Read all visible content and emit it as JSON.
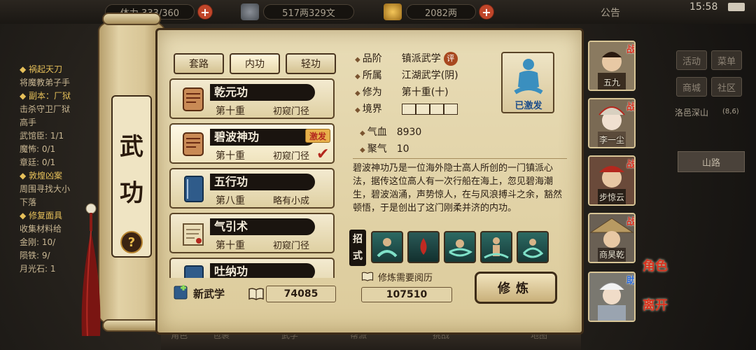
{
  "status_bar": {
    "stamina": "体力 333/360",
    "money": "517两329文",
    "gold": "2082两",
    "announcement": "公告",
    "clock": "15:58"
  },
  "quest_log": {
    "lines": [
      "◆ 祸起天刀",
      "将魔教弟子手",
      "◆ 副本：厂狱",
      "击杀守卫厂狱",
      "高手",
      "武馆臣: 1/1",
      "魔怖: 0/1",
      "章廷: 0/1",
      "◆ 敦煌凶案",
      "周围寻找大小",
      "下落",
      "◆ 修复面具",
      "收集材料给",
      "金刚: 10/",
      "陨铁: 9/",
      "月光石: 1"
    ]
  },
  "right_menu": {
    "activity": "活动",
    "menu": "菜单",
    "shop": "商城",
    "community": "社区",
    "location": "洛邑深山",
    "location_coords": "(8,6)",
    "area_label": "山路"
  },
  "scroll_title": {
    "char1": "武",
    "char2": "功",
    "help": "?"
  },
  "tabs": [
    {
      "label": "套路"
    },
    {
      "label": "内功"
    },
    {
      "label": "轻功"
    }
  ],
  "skills": [
    {
      "name": "乾元功",
      "level": "第十重",
      "stage": "初窥门径",
      "badge": ""
    },
    {
      "name": "碧波神功",
      "level": "第十重",
      "stage": "初窥门径",
      "badge": "激发"
    },
    {
      "name": "五行功",
      "level": "第八重",
      "stage": "略有小成",
      "badge": ""
    },
    {
      "name": "气引术",
      "level": "第十重",
      "stage": "初窥门径",
      "badge": ""
    },
    {
      "name": "吐纳功",
      "level": "",
      "stage": "",
      "badge": ""
    }
  ],
  "new_skill": {
    "label": "新武学",
    "points": "74085"
  },
  "detail": {
    "grade_label": "品阶",
    "grade_value": "镇派武学",
    "grade_tag": "评",
    "belong_label": "所属",
    "belong_value": "江湖武学(阴)",
    "cultivation_label": "修为",
    "cultivation_value": "第十重(十)",
    "realm_label": "境界",
    "status": "已激发",
    "qixue_label": "气血",
    "qixue_value": "8930",
    "juqi_label": "聚气",
    "juqi_value": "10",
    "description": "碧波神功乃是一位海外隐士高人所创的一门镇派心法，据传这位高人有一次行船在海上，忽见碧海潮生，碧波汹涌，声势惊人，在与风浪搏斗之余，豁然顿悟，于是创出了这门刚柔并济的内功。",
    "moves_label": "招式",
    "need_label": "修炼需要阅历",
    "need_value": "107510",
    "train_button": "修炼"
  },
  "party": [
    {
      "name": "五九",
      "tag": "战"
    },
    {
      "name": "李一尘",
      "tag": "战"
    },
    {
      "name": "步惊云",
      "tag": "战"
    },
    {
      "name": "商昊乾",
      "tag": "战"
    },
    {
      "name": "",
      "tag": "助"
    }
  ],
  "side_buttons": {
    "role": "角色",
    "leave": "离开"
  },
  "bottom_bar": {
    "items": [
      "角色",
      "包裹",
      "武学",
      "帮派",
      "挑战",
      "地图"
    ]
  }
}
